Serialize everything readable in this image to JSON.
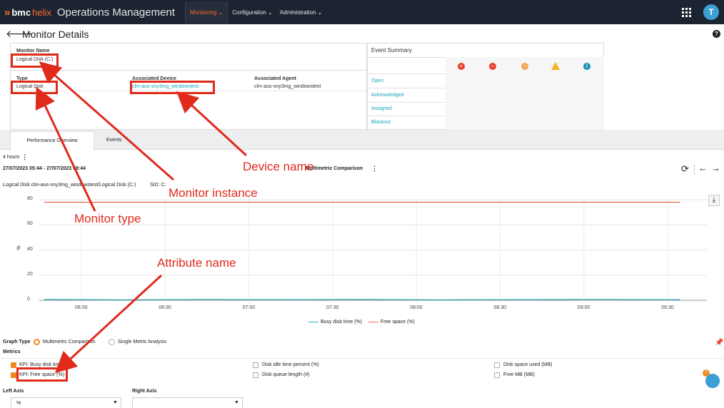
{
  "header": {
    "brand_bmc": "bmc",
    "brand_helix": "helix",
    "app_name": "Operations Management",
    "nav": [
      "Monitoring ⌄",
      "Configuration ⌄",
      "Administration ⌄"
    ],
    "avatar_letter": "T"
  },
  "page": {
    "title": "Monitor Details",
    "help": "?"
  },
  "monitor": {
    "name_label": "Monitor Name",
    "name_value": "Logical Disk (C:)",
    "type_label": "Type",
    "type_value": "Logical Disk",
    "device_label": "Associated Device",
    "device_value": "clm-aus-sny3mg_windowstest",
    "agent_label": "Associated Agent",
    "agent_value": "clm-aus-sny3mg_windowstest"
  },
  "event_summary": {
    "title": "Event Summary",
    "rows": [
      "Open",
      "Acknowledged",
      "Assigned",
      "Blackout"
    ],
    "severity_colors": [
      "#e8412c",
      "#e8412c",
      "#f3a35a",
      "#f6b21b",
      "#1b8fb5"
    ]
  },
  "tabs": [
    "Performance Overview",
    "Events"
  ],
  "timerange": {
    "label": "4 hours",
    "range": "27/07/2023 05:44 - 27/07/2023 09:44"
  },
  "chart_header": {
    "path": "Logical Disk clm-aus-sny3mg_windowstest/Logical Disk (C:)",
    "sid_label": "SID: C:",
    "comparison_label": "Multimetric Comparison"
  },
  "chart_data": {
    "type": "line",
    "ylabel": "%",
    "ylim": [
      0,
      80
    ],
    "y_ticks": [
      "80",
      "60",
      "40",
      "20",
      "0"
    ],
    "x_ticks": [
      "06:00",
      "06:30",
      "07:00",
      "07:30",
      "08:00",
      "08:30",
      "09:00",
      "09:30"
    ],
    "series": [
      {
        "name": "Busy disk time (%)",
        "color": "#2aa9b8",
        "values": [
          0.6,
          0.4,
          0.7,
          0.5,
          0.6,
          0.4,
          0.5,
          0.7,
          0.5
        ]
      },
      {
        "name": "Free space (%)",
        "color": "#e8674f",
        "values": [
          78,
          78,
          78,
          78,
          78,
          78,
          78,
          78,
          78
        ]
      }
    ]
  },
  "graph_type": {
    "label": "Graph Type",
    "options": [
      "Multimetric Comparison",
      "Single Metric Analysis"
    ]
  },
  "metrics": {
    "label": "Metrics",
    "items": [
      {
        "text": "KPI: Busy disk time (%)",
        "checked": true
      },
      {
        "text": "KPI: Free space (%)",
        "checked": true
      },
      {
        "text": "Disk idle time percent (%)",
        "checked": false
      },
      {
        "text": "Disk queue length (#)",
        "checked": false
      },
      {
        "text": "Disk space used (MB)",
        "checked": false
      },
      {
        "text": "Free MB (MB)",
        "checked": false
      }
    ]
  },
  "axes": {
    "left_label": "Left Axis",
    "left_value": "%",
    "right_label": "Right Axis",
    "right_value": ""
  },
  "annotations": [
    "Device name",
    "Monitor instance",
    "Monitor type",
    "Attribute name"
  ],
  "badge_count": "7"
}
